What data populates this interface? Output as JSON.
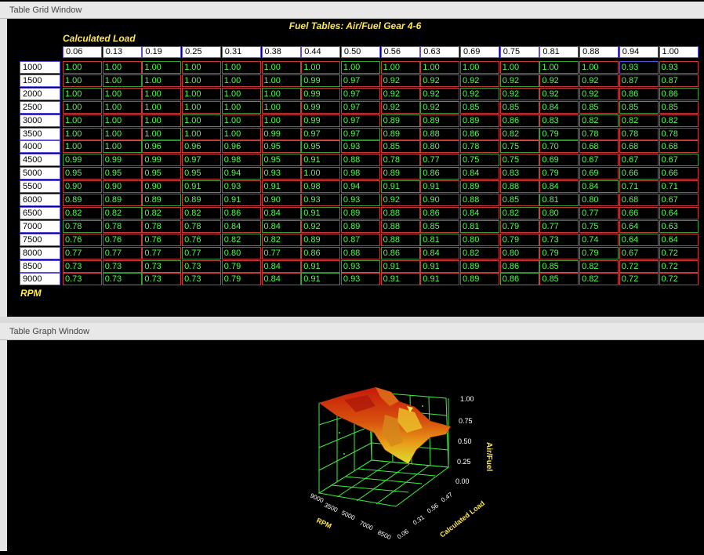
{
  "windows": {
    "grid_title": "Table Grid Window",
    "graph_title": "Table Graph Window"
  },
  "table": {
    "title": "Fuel Tables: Air/Fuel Gear 4-6",
    "col_axis_label": "Calculated Load",
    "row_axis_label": "RPM",
    "columns": [
      "0.06",
      "0.13",
      "0.19",
      "0.25",
      "0.31",
      "0.38",
      "0.44",
      "0.50",
      "0.56",
      "0.63",
      "0.69",
      "0.75",
      "0.81",
      "0.88",
      "0.94",
      "1.00"
    ],
    "rows": [
      {
        "rpm": "1000",
        "values": [
          "1.00",
          "1.00",
          "1.00",
          "1.00",
          "1.00",
          "1.00",
          "1.00",
          "1.00",
          "1.00",
          "1.00",
          "1.00",
          "1.00",
          "1.00",
          "1.00",
          "0.93",
          "0.93"
        ]
      },
      {
        "rpm": "1500",
        "values": [
          "1.00",
          "1.00",
          "1.00",
          "1.00",
          "1.00",
          "1.00",
          "0.99",
          "0.97",
          "0.92",
          "0.92",
          "0.92",
          "0.92",
          "0.92",
          "0.92",
          "0.87",
          "0.87"
        ]
      },
      {
        "rpm": "2000",
        "values": [
          "1.00",
          "1.00",
          "1.00",
          "1.00",
          "1.00",
          "1.00",
          "0.99",
          "0.97",
          "0.92",
          "0.92",
          "0.92",
          "0.92",
          "0.92",
          "0.92",
          "0.86",
          "0.86"
        ]
      },
      {
        "rpm": "2500",
        "values": [
          "1.00",
          "1.00",
          "1.00",
          "1.00",
          "1.00",
          "1.00",
          "0.99",
          "0.97",
          "0.92",
          "0.92",
          "0.85",
          "0.85",
          "0.84",
          "0.85",
          "0.85",
          "0.85"
        ]
      },
      {
        "rpm": "3000",
        "values": [
          "1.00",
          "1.00",
          "1.00",
          "1.00",
          "1.00",
          "1.00",
          "0.99",
          "0.97",
          "0.89",
          "0.89",
          "0.89",
          "0.86",
          "0.83",
          "0.82",
          "0.82",
          "0.82"
        ]
      },
      {
        "rpm": "3500",
        "values": [
          "1.00",
          "1.00",
          "1.00",
          "1.00",
          "1.00",
          "0.99",
          "0.97",
          "0.97",
          "0.89",
          "0.88",
          "0.86",
          "0.82",
          "0.79",
          "0.78",
          "0.78",
          "0.78"
        ]
      },
      {
        "rpm": "4000",
        "values": [
          "1.00",
          "1.00",
          "0.96",
          "0.96",
          "0.96",
          "0.95",
          "0.95",
          "0.93",
          "0.85",
          "0.80",
          "0.78",
          "0.75",
          "0.70",
          "0.68",
          "0.68",
          "0.68"
        ]
      },
      {
        "rpm": "4500",
        "values": [
          "0.99",
          "0.99",
          "0.99",
          "0.97",
          "0.98",
          "0.95",
          "0.91",
          "0.88",
          "0.78",
          "0.77",
          "0.75",
          "0.75",
          "0.69",
          "0.67",
          "0.67",
          "0.67"
        ]
      },
      {
        "rpm": "5000",
        "values": [
          "0.95",
          "0.95",
          "0.95",
          "0.95",
          "0.94",
          "0.93",
          "1.00",
          "0.98",
          "0.89",
          "0.86",
          "0.84",
          "0.83",
          "0.79",
          "0.69",
          "0.66",
          "0.66"
        ]
      },
      {
        "rpm": "5500",
        "values": [
          "0.90",
          "0.90",
          "0.90",
          "0.91",
          "0.93",
          "0.91",
          "0.98",
          "0.94",
          "0.91",
          "0.91",
          "0.89",
          "0.88",
          "0.84",
          "0.84",
          "0.71",
          "0.71"
        ]
      },
      {
        "rpm": "6000",
        "values": [
          "0.89",
          "0.89",
          "0.89",
          "0.89",
          "0.91",
          "0.90",
          "0.93",
          "0.93",
          "0.92",
          "0.90",
          "0.88",
          "0.85",
          "0.81",
          "0.80",
          "0.68",
          "0.67"
        ]
      },
      {
        "rpm": "6500",
        "values": [
          "0.82",
          "0.82",
          "0.82",
          "0.82",
          "0.86",
          "0.84",
          "0.91",
          "0.89",
          "0.88",
          "0.86",
          "0.84",
          "0.82",
          "0.80",
          "0.77",
          "0.66",
          "0.64"
        ]
      },
      {
        "rpm": "7000",
        "values": [
          "0.78",
          "0.78",
          "0.78",
          "0.78",
          "0.84",
          "0.84",
          "0.92",
          "0.89",
          "0.88",
          "0.85",
          "0.81",
          "0.79",
          "0.77",
          "0.75",
          "0.64",
          "0.63"
        ]
      },
      {
        "rpm": "7500",
        "values": [
          "0.76",
          "0.76",
          "0.76",
          "0.76",
          "0.82",
          "0.82",
          "0.89",
          "0.87",
          "0.88",
          "0.81",
          "0.80",
          "0.79",
          "0.73",
          "0.74",
          "0.64",
          "0.64"
        ]
      },
      {
        "rpm": "8000",
        "values": [
          "0.77",
          "0.77",
          "0.77",
          "0.77",
          "0.80",
          "0.77",
          "0.86",
          "0.88",
          "0.86",
          "0.84",
          "0.82",
          "0.80",
          "0.79",
          "0.79",
          "0.67",
          "0.72"
        ]
      },
      {
        "rpm": "8500",
        "values": [
          "0.73",
          "0.73",
          "0.73",
          "0.73",
          "0.79",
          "0.84",
          "0.91",
          "0.93",
          "0.91",
          "0.91",
          "0.89",
          "0.86",
          "0.85",
          "0.82",
          "0.72",
          "0.72"
        ]
      },
      {
        "rpm": "9000",
        "values": [
          "0.73",
          "0.73",
          "0.73",
          "0.73",
          "0.79",
          "0.84",
          "0.91",
          "0.93",
          "0.91",
          "0.91",
          "0.89",
          "0.86",
          "0.85",
          "0.82",
          "0.72",
          "0.72"
        ]
      }
    ]
  },
  "graph": {
    "z_axis_label": "Air/Fuel",
    "load_axis_label": "Calculated Load",
    "rpm_axis_label": "RPM",
    "z_ticks": [
      "1.00",
      "0.75",
      "0.50",
      "0.25",
      "0.00"
    ],
    "load_ticks": [
      "0.47",
      "0.56",
      "0.31",
      "0.06"
    ],
    "rpm_ticks": [
      "9000",
      "3500",
      "5000",
      "7000",
      "8500"
    ]
  },
  "colors": {
    "header_text": "#ffe84a",
    "value_text": "#4cff4c",
    "border_red": "#c83a3a",
    "border_green": "#3aa03a",
    "border_blue": "#5a4dd8",
    "grid_3d": "#3cf03c"
  }
}
